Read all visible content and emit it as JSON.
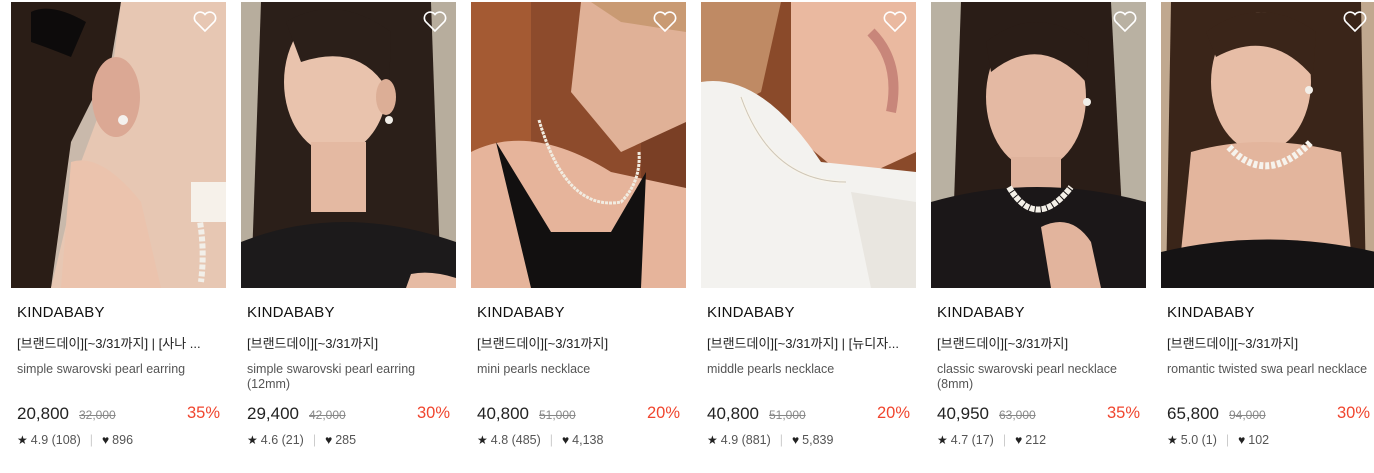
{
  "products": [
    {
      "brand": "KINDABABY",
      "title": "[브랜드데이][~3/31까지] | [사나 ...",
      "subtitle": "simple swarovski pearl earring",
      "price": "20,800",
      "original_price": "32,000",
      "discount": "35%",
      "rating": "4.9 (108)",
      "likes": "896",
      "wishlist_icon": "heart-outline-icon",
      "rating_icon": "star-icon",
      "likes_icon": "heart-filled-icon"
    },
    {
      "brand": "KINDABABY",
      "title": "[브랜드데이][~3/31까지]",
      "subtitle": "simple swarovski pearl earring (12mm)",
      "price": "29,400",
      "original_price": "42,000",
      "discount": "30%",
      "rating": "4.6 (21)",
      "likes": "285",
      "wishlist_icon": "heart-outline-icon",
      "rating_icon": "star-icon",
      "likes_icon": "heart-filled-icon"
    },
    {
      "brand": "KINDABABY",
      "title": "[브랜드데이][~3/31까지]",
      "subtitle": "mini pearls necklace",
      "price": "40,800",
      "original_price": "51,000",
      "discount": "20%",
      "rating": "4.8 (485)",
      "likes": "4,138",
      "wishlist_icon": "heart-outline-icon",
      "rating_icon": "star-icon",
      "likes_icon": "heart-filled-icon"
    },
    {
      "brand": "KINDABABY",
      "title": "[브랜드데이][~3/31까지] | [뉴디자...",
      "subtitle": "middle pearls necklace",
      "price": "40,800",
      "original_price": "51,000",
      "discount": "20%",
      "rating": "4.9 (881)",
      "likes": "5,839",
      "wishlist_icon": "heart-outline-icon",
      "rating_icon": "star-icon",
      "likes_icon": "heart-filled-icon"
    },
    {
      "brand": "KINDABABY",
      "title": "[브랜드데이][~3/31까지]",
      "subtitle": "classic swarovski pearl necklace (8mm)",
      "price": "40,950",
      "original_price": "63,000",
      "discount": "35%",
      "rating": "4.7 (17)",
      "likes": "212",
      "wishlist_icon": "heart-outline-icon",
      "rating_icon": "star-icon",
      "likes_icon": "heart-filled-icon"
    },
    {
      "brand": "KINDABABY",
      "title": "[브랜드데이][~3/31까지]",
      "subtitle": "romantic twisted swa pearl necklace",
      "price": "65,800",
      "original_price": "94,000",
      "discount": "30%",
      "rating": "5.0 (1)",
      "likes": "102",
      "wishlist_icon": "heart-outline-icon",
      "rating_icon": "star-icon",
      "likes_icon": "heart-filled-icon"
    }
  ],
  "colors": {
    "discount": "#f0462f",
    "text": "#222222",
    "muted": "#888888"
  }
}
